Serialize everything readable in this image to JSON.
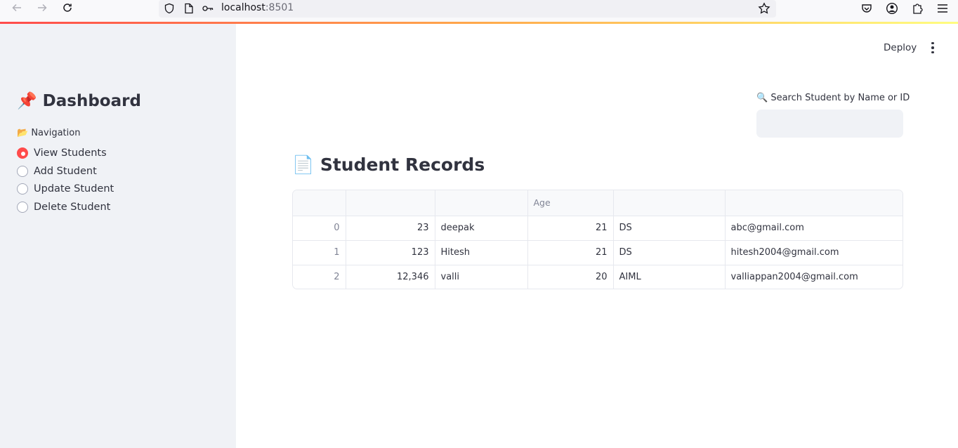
{
  "browser": {
    "url_host": "localhost",
    "url_port": ":8501"
  },
  "sidebar": {
    "title": "📌 Dashboard",
    "nav_label": "📂 Navigation",
    "items": [
      {
        "label": "View Students",
        "selected": true
      },
      {
        "label": "Add Student",
        "selected": false
      },
      {
        "label": "Update Student",
        "selected": false
      },
      {
        "label": "Delete Student",
        "selected": false
      }
    ]
  },
  "header": {
    "deploy_label": "Deploy"
  },
  "search": {
    "label": "🔍 Search Student by Name or ID",
    "value": ""
  },
  "main": {
    "title": "📄 Student Records",
    "table": {
      "columns": [
        "",
        "",
        "",
        "Age",
        "",
        ""
      ],
      "rows": [
        [
          "0",
          "23",
          "deepak",
          "21",
          "DS",
          "abc@gmail.com"
        ],
        [
          "1",
          "123",
          "Hitesh",
          "21",
          "DS",
          "hitesh2004@gmail.com"
        ],
        [
          "2",
          "12,346",
          "valli",
          "20",
          "AIML",
          "valliappan2004@gmail.com"
        ]
      ]
    }
  },
  "colors": {
    "accent": "#ff4b4b",
    "sidebar_bg": "#f0f2f6",
    "text": "#31333f"
  }
}
